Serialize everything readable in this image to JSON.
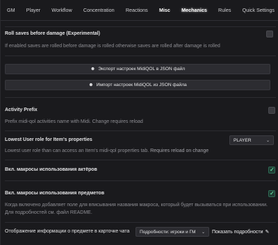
{
  "tabs": [
    {
      "label": "GM"
    },
    {
      "label": "Player"
    },
    {
      "label": "Workflow"
    },
    {
      "label": "Concentration"
    },
    {
      "label": "Reactions"
    },
    {
      "label": "Misc"
    },
    {
      "label": "Mechanics"
    },
    {
      "label": "Rules"
    },
    {
      "label": "Quick Settings"
    }
  ],
  "roll_saves": {
    "label": "Roll saves before damage (Experimental)",
    "hint": "If enabled saves are rolled before damage is rolled otherwise saves are rolled after damage is rolled",
    "checked": false
  },
  "export_button": {
    "label": "Экспорт настроек MidiQOL в JSON файл",
    "icon": "download-icon"
  },
  "import_button": {
    "label": "Импорт настроек MidiQOL из JSON файла",
    "icon": "upload-icon"
  },
  "activity_prefix": {
    "label": "Activity Prefix",
    "hint": "Prefix midi-qol activities name with Midi. Change requires reload",
    "checked": false
  },
  "lowest_role": {
    "label": "Lowest User role for Item's properties",
    "hint": "Lowest user role than can access an Item's midi-qol properties tab.",
    "hint_bold": "Requires reload on change",
    "value": "PLAYER"
  },
  "actor_macros": {
    "label": "Вкл. макросы использования актёров",
    "checked": true
  },
  "item_macros": {
    "label": "Вкл. макросы использования предметов",
    "hint": "Когда включено добавляет поле для вписывания названия макроса, который будет вызываться при использовании. Для подробностей см. файл README.",
    "checked": true
  },
  "chat_card": {
    "label": "Отображение информации о предмете в карточке чата",
    "select_value": "Подробности: игроки и ГМ",
    "show_details": "Показать подробности"
  },
  "colors": {
    "check": "#5fd39a",
    "bg": "#1a1a1d"
  }
}
